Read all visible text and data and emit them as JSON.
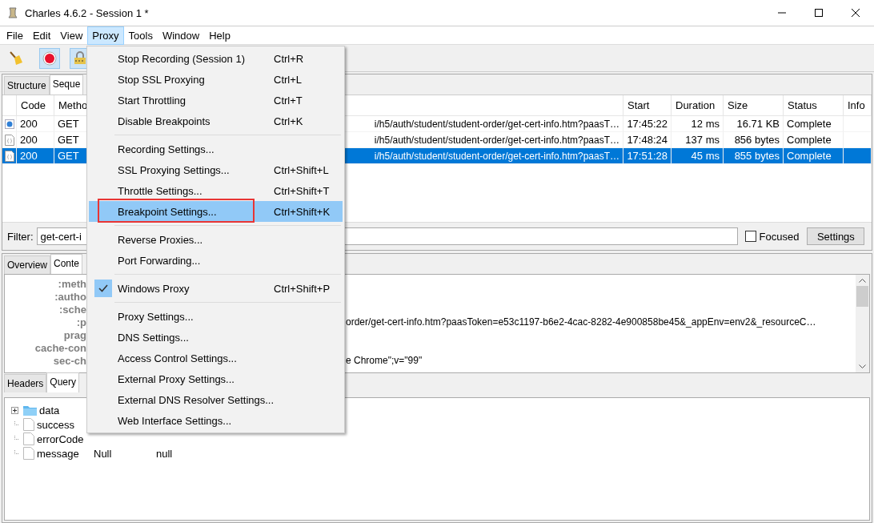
{
  "window": {
    "title": "Charles 4.6.2 - Session 1 *"
  },
  "menubar": [
    {
      "label": "File",
      "selected": false
    },
    {
      "label": "Edit",
      "selected": false
    },
    {
      "label": "View",
      "selected": false
    },
    {
      "label": "Proxy",
      "selected": true
    },
    {
      "label": "Tools",
      "selected": false
    },
    {
      "label": "Window",
      "selected": false
    },
    {
      "label": "Help",
      "selected": false
    }
  ],
  "toolbar": [
    {
      "kind": "broom",
      "on": false
    },
    {
      "kind": "record",
      "on": true
    },
    {
      "kind": "lock",
      "on": true
    }
  ],
  "top_tabs": [
    {
      "label": "Structure",
      "selected": false
    },
    {
      "label": "Seque",
      "selected": true
    }
  ],
  "table": {
    "columns": [
      "Code",
      "Metho",
      "",
      "Start",
      "Duration",
      "Size",
      "Status",
      "Info"
    ],
    "rows": [
      {
        "kind": "dot",
        "selected": false,
        "cells": [
          "200",
          "GET",
          "i/h5/auth/student/student-order/get-cert-info.htm?paasT…",
          "17:45:22",
          "12 ms",
          "16.71 KB",
          "Complete"
        ]
      },
      {
        "kind": "doc",
        "selected": false,
        "cells": [
          "200",
          "GET",
          "i/h5/auth/student/student-order/get-cert-info.htm?paasT…",
          "17:48:24",
          "137 ms",
          "856 bytes",
          "Complete"
        ]
      },
      {
        "kind": "doc",
        "selected": true,
        "cells": [
          "200",
          "GET",
          "i/h5/auth/student/student-order/get-cert-info.htm?paasT…",
          "17:51:28",
          "45 ms",
          "855 bytes",
          "Complete"
        ]
      }
    ]
  },
  "filter": {
    "label": "Filter:",
    "value": "get-cert-i",
    "focused": {
      "label": "Focused",
      "checked": false
    },
    "button": "Settings"
  },
  "detail_tabs": [
    {
      "label": "Overview",
      "selected": false
    },
    {
      "label": "Conte",
      "selected": true
    }
  ],
  "headers": [
    {
      "name": ":meth"
    },
    {
      "name": ":autho"
    },
    {
      "name": ":sche"
    },
    {
      "name": ":p",
      "value": "order/get-cert-info.htm?paasToken=e53c1197-b6e2-4cac-8282-4e900858be45&_appEnv=env2&_resourceC…"
    },
    {
      "name": "prag"
    },
    {
      "name": "cache-con"
    },
    {
      "name": "sec-ch",
      "value": "e Chrome\";v=\"99\""
    }
  ],
  "body_tabs": [
    {
      "label": "Headers",
      "selected": false
    },
    {
      "label": "Query",
      "selected": true
    }
  ],
  "tree": [
    {
      "kind": "folder",
      "expanded": false,
      "name": "data"
    },
    {
      "kind": "file",
      "name": "success"
    },
    {
      "kind": "file",
      "name": "errorCode"
    },
    {
      "kind": "file",
      "name": "message",
      "type": "Null",
      "value": "null"
    }
  ],
  "menu": [
    {
      "kind": "item",
      "label": "Stop Recording (Session 1)",
      "shortcut": "Ctrl+R",
      "selected": false
    },
    {
      "kind": "item",
      "label": "Stop SSL Proxying",
      "shortcut": "Ctrl+L",
      "selected": false
    },
    {
      "kind": "item",
      "label": "Start Throttling",
      "shortcut": "Ctrl+T",
      "selected": false
    },
    {
      "kind": "item",
      "label": "Disable Breakpoints",
      "shortcut": "Ctrl+K",
      "selected": false
    },
    {
      "kind": "separator"
    },
    {
      "kind": "item",
      "label": "Recording Settings...",
      "selected": false
    },
    {
      "kind": "item",
      "label": "SSL Proxying Settings...",
      "shortcut": "Ctrl+Shift+L",
      "selected": false
    },
    {
      "kind": "item",
      "label": "Throttle Settings...",
      "shortcut": "Ctrl+Shift+T",
      "selected": false
    },
    {
      "kind": "item",
      "label": "Breakpoint Settings...",
      "shortcut": "Ctrl+Shift+K",
      "selected": true,
      "outlined": true
    },
    {
      "kind": "separator"
    },
    {
      "kind": "item",
      "label": "Reverse Proxies...",
      "selected": false
    },
    {
      "kind": "item",
      "label": "Port Forwarding...",
      "selected": false
    },
    {
      "kind": "separator"
    },
    {
      "kind": "item",
      "label": "Windows Proxy",
      "shortcut": "Ctrl+Shift+P",
      "selected": false,
      "checked": true
    },
    {
      "kind": "separator"
    },
    {
      "kind": "item",
      "label": "Proxy Settings...",
      "selected": false
    },
    {
      "kind": "item",
      "label": "DNS Settings...",
      "selected": false
    },
    {
      "kind": "item",
      "label": "Access Control Settings...",
      "selected": false
    },
    {
      "kind": "item",
      "label": "External Proxy Settings...",
      "selected": false
    },
    {
      "kind": "item",
      "label": "External DNS Resolver Settings...",
      "selected": false
    },
    {
      "kind": "item",
      "label": "Web Interface Settings...",
      "selected": false
    }
  ]
}
